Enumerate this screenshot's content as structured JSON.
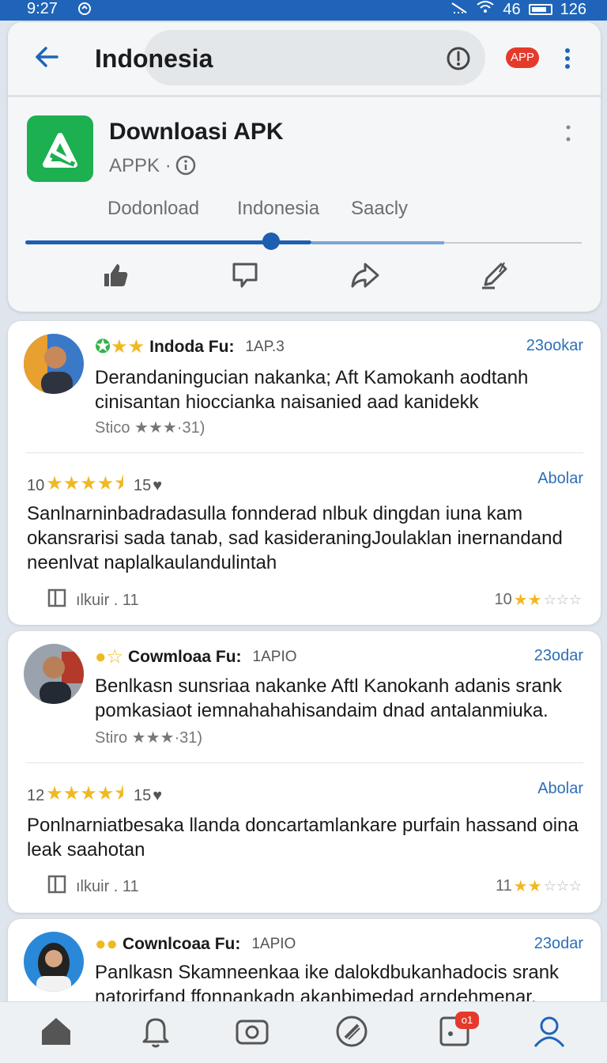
{
  "status_bar": {
    "time": "9:27",
    "network": "46",
    "battery": "126"
  },
  "header": {
    "title": "Indonesia",
    "app_badge": "APP"
  },
  "app": {
    "name": "Downloasi APK",
    "subtitle": "APPK ·"
  },
  "tabs": [
    {
      "label": "Dodonload"
    },
    {
      "label": "Indonesia"
    },
    {
      "label": "Saacly"
    }
  ],
  "reviews": [
    {
      "name": "Indoda Fu:",
      "code": "1AP.3",
      "link": "23ookar",
      "text": "Derandaningucian nakanka; Aft Kamokanh aodtanh cinisantan hioccianka naisanied aad kanidekk",
      "meta": "Stico ★★★·31)",
      "score_count": "10",
      "likes": "15",
      "sub_link": "Abolar",
      "sub_text": "Sanlnarninbadradasulla fonnderad nlbuk dingdan iuna kam okansrarisi sada tanab, sad kasideraningJoulaklan inernandand neenlvat naplalkaulandulintah",
      "footer_left": "ılkuir . 11",
      "footer_right": "10",
      "colors": {
        "avatar_bg": "#3a78c8"
      }
    },
    {
      "name": "Cowmloaa Fu:",
      "code": "1APIO",
      "link": "23odar",
      "text": "Benlkasn sunsriaa nakanke Aftl Kanokanh adanis srank pomkasiaot iemnahahahisandaim dnad antalanmiuka.",
      "meta": "Stiro ★★★·31)",
      "score_count": "12",
      "likes": "15",
      "sub_link": "Abolar",
      "sub_text": "Ponlnarniatbesaka llanda doncartamlankare purfain hassand oina leak saahotan",
      "footer_left": "ılkuir . 11",
      "footer_right": "11",
      "colors": {
        "avatar_bg": "#9aa3ad"
      }
    },
    {
      "name": "Cownlcoaa Fu:",
      "code": "1APIO",
      "link": "23odar",
      "text": "Panlkasn Skamneenkaa ike dalokdbukanhadocis srank natorirfand ffonnankadn akanbimedad arndehmenar.",
      "colors": {
        "avatar_bg": "#2a88d8"
      }
    }
  ],
  "bottom_nav": {
    "badge": "o1"
  }
}
